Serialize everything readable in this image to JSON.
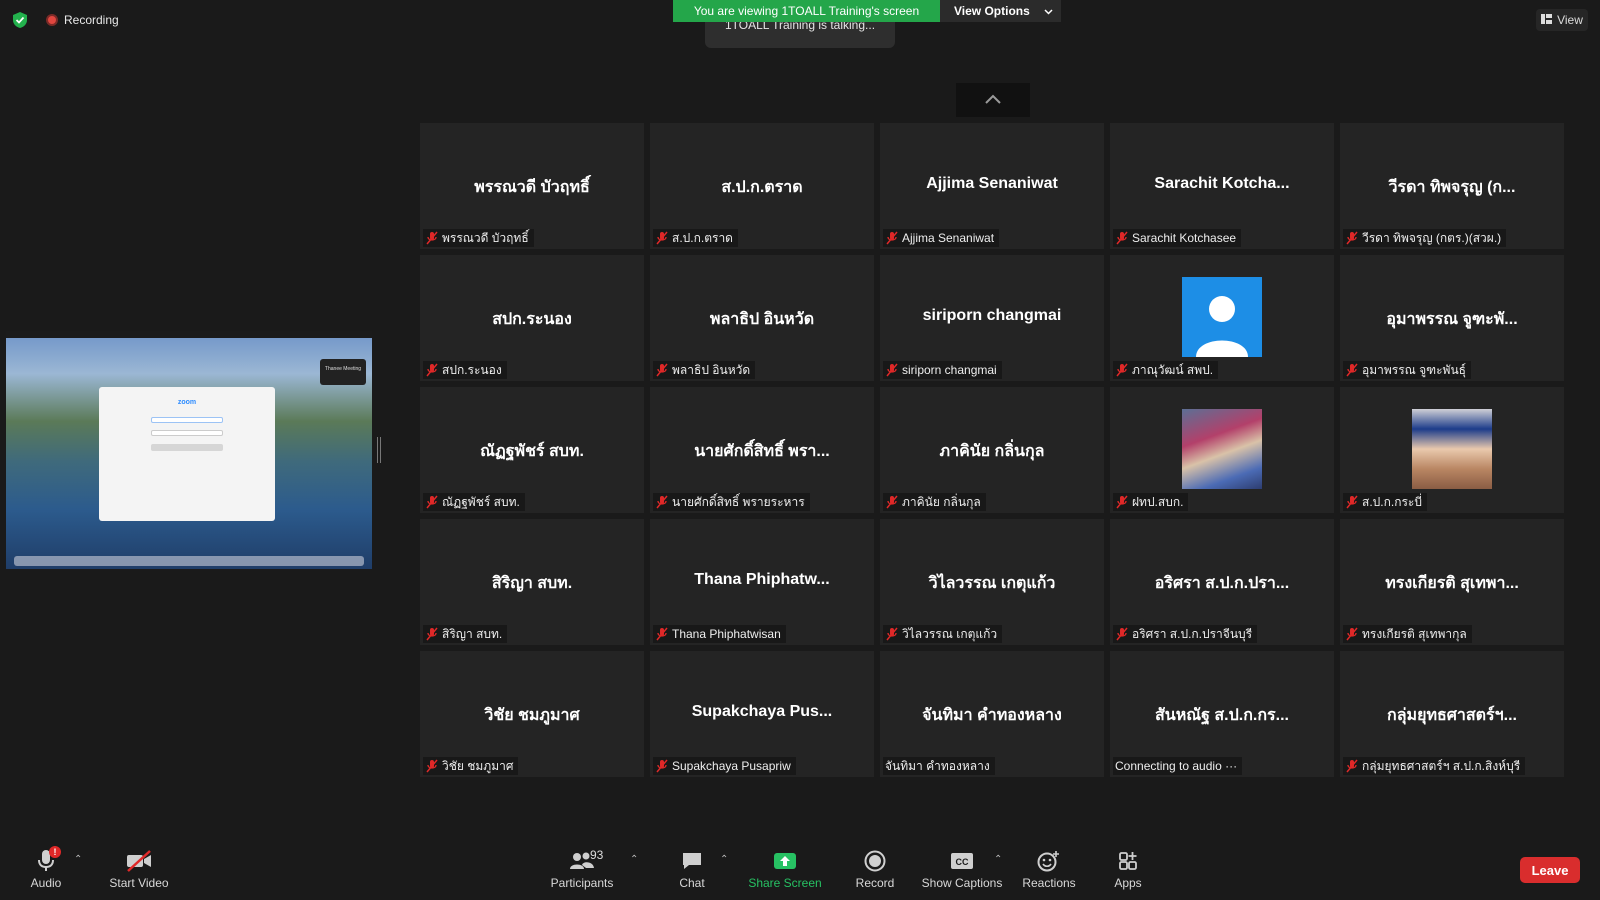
{
  "top": {
    "recording_label": "Recording",
    "banner_text": "You are viewing 1TOALL Training's screen",
    "view_options_label": "View Options",
    "talking_text": "1TOALL Training is talking...",
    "view_label": "View"
  },
  "tiles": [
    {
      "name": "พรรณวดี บัวฤทธิ์",
      "label": "พรรณวดี บัวฤทธิ์",
      "muted": true,
      "avatar": ""
    },
    {
      "name": "ส.ป.ก.ตราด",
      "label": "ส.ป.ก.ตราด",
      "muted": true,
      "avatar": ""
    },
    {
      "name": "Ajjima Senaniwat",
      "label": "Ajjima Senaniwat",
      "muted": true,
      "avatar": ""
    },
    {
      "name": "Sarachit  Kotcha...",
      "label": "Sarachit Kotchasee",
      "muted": true,
      "avatar": ""
    },
    {
      "name": "วีรดา ทิพจรุญ (ก...",
      "label": "วีรดา ทิพจรุญ (กตร.)(สวผ.)",
      "muted": true,
      "avatar": ""
    },
    {
      "name": "สปก.ระนอง",
      "label": "สปก.ระนอง",
      "muted": true,
      "avatar": ""
    },
    {
      "name": "พลาธิป อินหวัด",
      "label": "พลาธิป อินหวัด",
      "muted": true,
      "avatar": ""
    },
    {
      "name": "siriporn changmai",
      "label": "siriporn changmai",
      "muted": true,
      "avatar": ""
    },
    {
      "name": "",
      "label": "ภาณุวัฒน์  สพป.",
      "muted": true,
      "avatar": "default"
    },
    {
      "name": "อุมาพรรณ จูฑะพั...",
      "label": "อุมาพรรณ จูฑะพันธ์ุ",
      "muted": true,
      "avatar": ""
    },
    {
      "name": "ณัฏฐพัชร์ สบท.",
      "label": "ณัฏฐพัชร์ สบท.",
      "muted": true,
      "avatar": ""
    },
    {
      "name": "นายศักดิ์สิทธิ์ พรา...",
      "label": "นายศักดิ์สิทธิ์ พรายระหาร",
      "muted": true,
      "avatar": ""
    },
    {
      "name": "ภาคินัย กลิ่นกุล",
      "label": "ภาคินัย กลิ่นกุล",
      "muted": true,
      "avatar": ""
    },
    {
      "name": "",
      "label": "ฝทป.สบก.",
      "muted": true,
      "avatar": "photo1"
    },
    {
      "name": "",
      "label": "ส.ป.ก.กระบี่",
      "muted": true,
      "avatar": "photo2"
    },
    {
      "name": "สิริญา สบท.",
      "label": "สิริญา สบท.",
      "muted": true,
      "avatar": ""
    },
    {
      "name": "Thana  Phiphatw...",
      "label": "Thana Phiphatwisan",
      "muted": true,
      "avatar": ""
    },
    {
      "name": "วิไลวรรณ เกตุแก้ว",
      "label": "วิไลวรรณ เกตุแก้ว",
      "muted": true,
      "avatar": ""
    },
    {
      "name": "อริศรา ส.ป.ก.ปรา...",
      "label": "อริศรา ส.ป.ก.ปราจีนบุรี",
      "muted": true,
      "avatar": ""
    },
    {
      "name": "ทรงเกียรติ สุเทพา...",
      "label": "ทรงเกียรติ สุเทพากุล",
      "muted": true,
      "avatar": ""
    },
    {
      "name": "วิชัย ชมภูมาศ",
      "label": "วิชัย ชมภูมาศ",
      "muted": true,
      "avatar": ""
    },
    {
      "name": "Supakchaya  Pus...",
      "label": "Supakchaya Pusapriw",
      "muted": true,
      "avatar": ""
    },
    {
      "name": "จันทิมา คำทองหลาง",
      "label": "จันทิมา คำทองหลาง",
      "muted": false,
      "avatar": ""
    },
    {
      "name": "สันหณัฐ ส.ป.ก.กร...",
      "label": "Connecting to audio ···",
      "muted": false,
      "avatar": ""
    },
    {
      "name": "กลุ่มยุทธศาสตร์ฯ...",
      "label": "กลุ่มยุทธศาสตร์ฯ ส.ป.ก.สิงห์บุรี",
      "muted": true,
      "avatar": ""
    }
  ],
  "shared_screen": {
    "app_logo": "zoom",
    "panel_title": "Thanee Meeting"
  },
  "toolbar": {
    "audio_label": "Audio",
    "audio_badge": "!",
    "video_label": "Start Video",
    "participants_label": "Participants",
    "participants_count": "93",
    "chat_label": "Chat",
    "share_label": "Share Screen",
    "record_label": "Record",
    "captions_label": "Show Captions",
    "reactions_label": "Reactions",
    "apps_label": "Apps",
    "leave_label": "Leave",
    "share_color": "#27c163",
    "leave_color": "#d92d2d"
  }
}
